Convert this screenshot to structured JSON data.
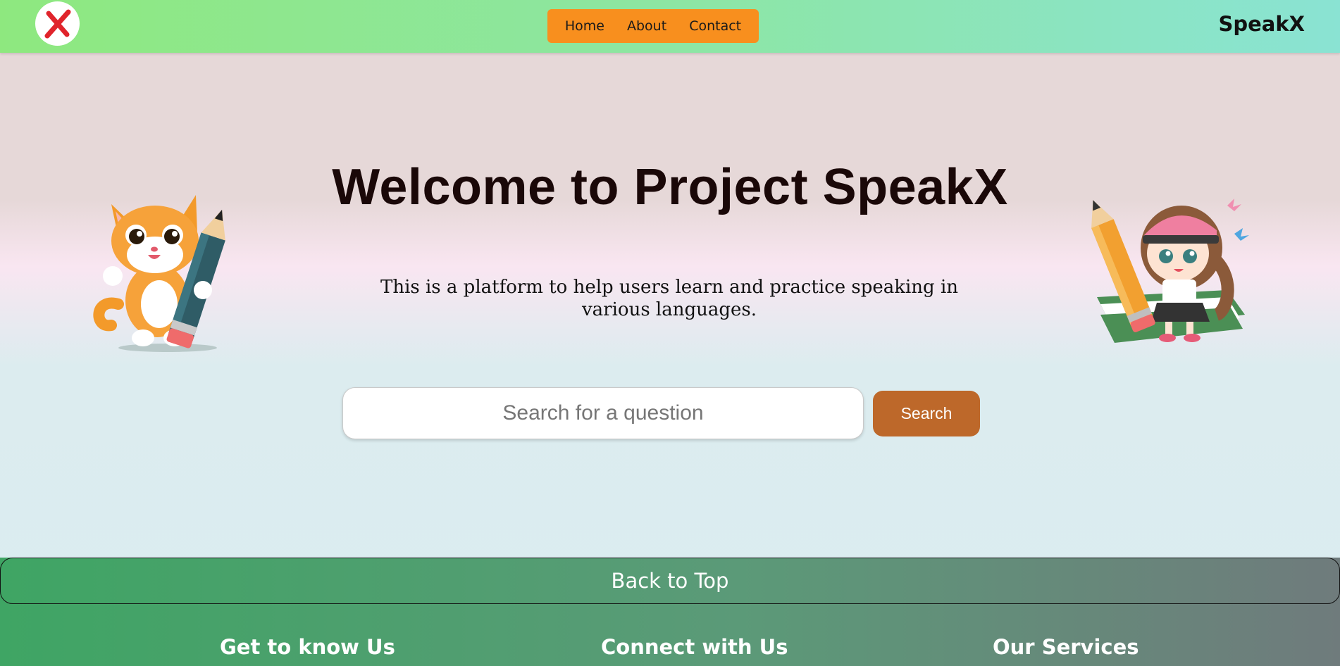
{
  "header": {
    "logo_icon": "close-x-icon",
    "nav": [
      "Home",
      "About",
      "Contact"
    ],
    "brand": "SpeakX"
  },
  "hero": {
    "title": "Welcome to Project SpeakX",
    "subtitle": "This is a platform to help users learn and practice speaking in various languages."
  },
  "search": {
    "placeholder": "Search for a question",
    "value": "",
    "button_label": "Search"
  },
  "footer": {
    "back_to_top": "Back to Top",
    "columns": [
      "Get to know Us",
      "Connect with Us",
      "Our Services"
    ]
  },
  "colors": {
    "nav_bg": "#f88f1e",
    "search_button": "#bd682a",
    "footer_start": "#3fa564",
    "footer_end": "#6f7b7c"
  }
}
